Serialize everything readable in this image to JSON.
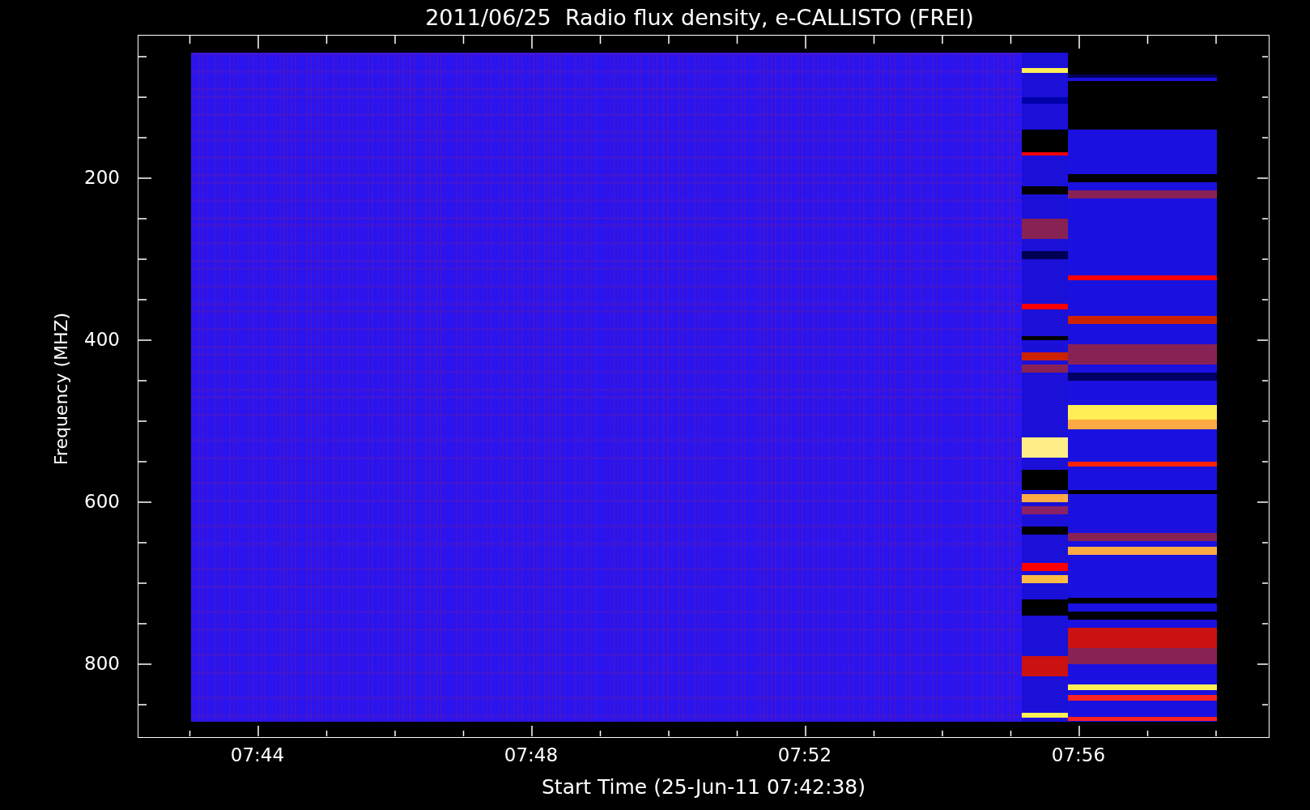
{
  "title": "2011/06/25  Radio flux density, e-CALLISTO (FREI)",
  "y_axis": {
    "title": "Frequency (MHZ)",
    "tick_labels": [
      "200",
      "400",
      "600",
      "800"
    ]
  },
  "x_axis": {
    "title": "Start Time (25-Jun-11 07:42:38)",
    "tick_labels": [
      "07:44",
      "07:48",
      "07:52",
      "07:56"
    ]
  }
}
